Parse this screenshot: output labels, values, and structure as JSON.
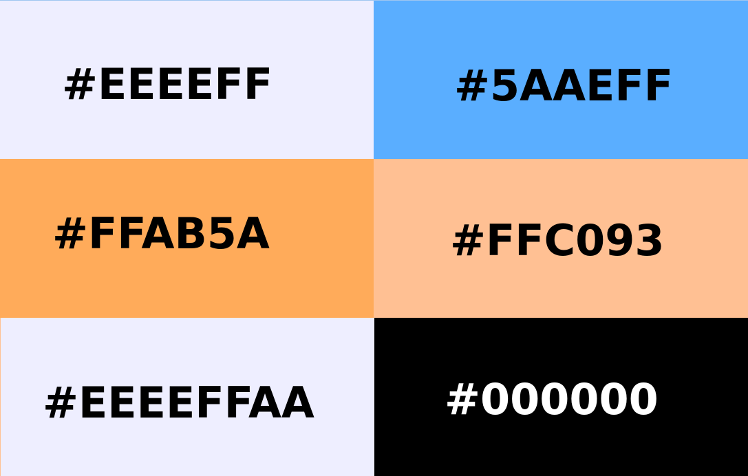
{
  "swatches": [
    {
      "label": "#EEEEFF",
      "background": "#EEEEFF",
      "text_color": "#000000"
    },
    {
      "label": "#5AAEFF",
      "background": "#5AAEFF",
      "text_color": "#000000"
    },
    {
      "label": "#FFAB5A",
      "background": "#FFAB5A",
      "text_color": "#000000"
    },
    {
      "label": "#FFC093",
      "background": "#FFC093",
      "text_color": "#000000"
    },
    {
      "label": "#EEEEFFAA",
      "background": "#EEEEFF",
      "text_color": "#000000"
    },
    {
      "label": "#000000",
      "background": "#000000",
      "text_color": "#FFFFFF"
    }
  ]
}
